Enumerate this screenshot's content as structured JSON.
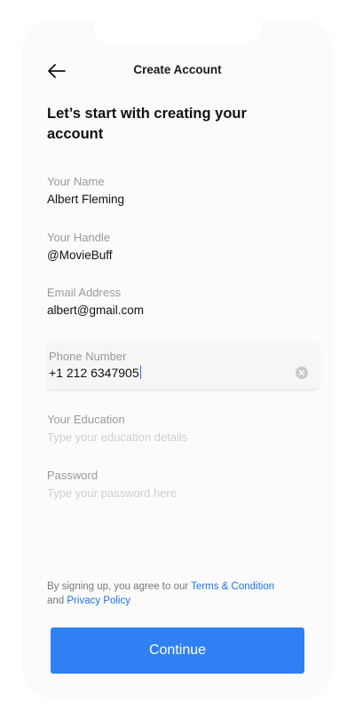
{
  "header": {
    "title": "Create Account"
  },
  "heading": "Let’s start with creating your account",
  "fields": {
    "name": {
      "label": "Your Name",
      "value": "Albert Fleming"
    },
    "handle": {
      "label": "Your Handle",
      "value": "@MovieBuff"
    },
    "email": {
      "label": "Email Address",
      "value": "albert@gmail.com"
    },
    "phone": {
      "label": "Phone Number",
      "value": "+1 212 6347905"
    },
    "education": {
      "label": "Your Education",
      "placeholder": "Type your education details"
    },
    "password": {
      "label": "Password",
      "placeholder": "Type your password here"
    }
  },
  "terms": {
    "prefix": "By signing up, you agree to our ",
    "terms_link": "Terms & Condition",
    "conjunction": " and ",
    "privacy_link": "Privacy Policy"
  },
  "continue_label": "Continue",
  "colors": {
    "accent": "#2f80f3",
    "link": "#1e73e8"
  },
  "icons": {
    "back": "arrow-left-icon",
    "clear": "clear-circle-icon"
  }
}
